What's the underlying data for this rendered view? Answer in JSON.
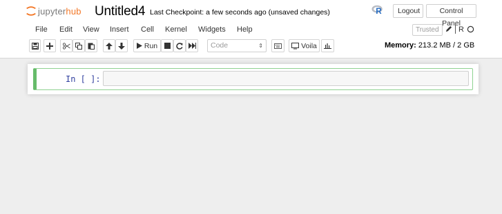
{
  "header": {
    "logo": {
      "jupyter": "jupyter",
      "hub": "hub"
    },
    "notebook_title": "Untitled4",
    "checkpoint": "Last Checkpoint: a few seconds ago  (unsaved changes)",
    "logout_label": "Logout",
    "control_panel_label": "Control Panel",
    "r_icon": "R"
  },
  "menu": {
    "items": [
      "File",
      "Edit",
      "View",
      "Insert",
      "Cell",
      "Kernel",
      "Widgets",
      "Help"
    ],
    "trusted_label": "Trusted",
    "kernel_label": "R"
  },
  "toolbar": {
    "run_label": "Run",
    "cell_type": "Code",
    "voila_label": "Voila",
    "memory_label": "Memory:",
    "memory_value": "213.2 MB / 2 GB"
  },
  "cell": {
    "prompt": "In [ ]:"
  },
  "colors": {
    "accent": "#f37726",
    "cell_border": "#66bb6a",
    "prompt": "#303f9f"
  }
}
